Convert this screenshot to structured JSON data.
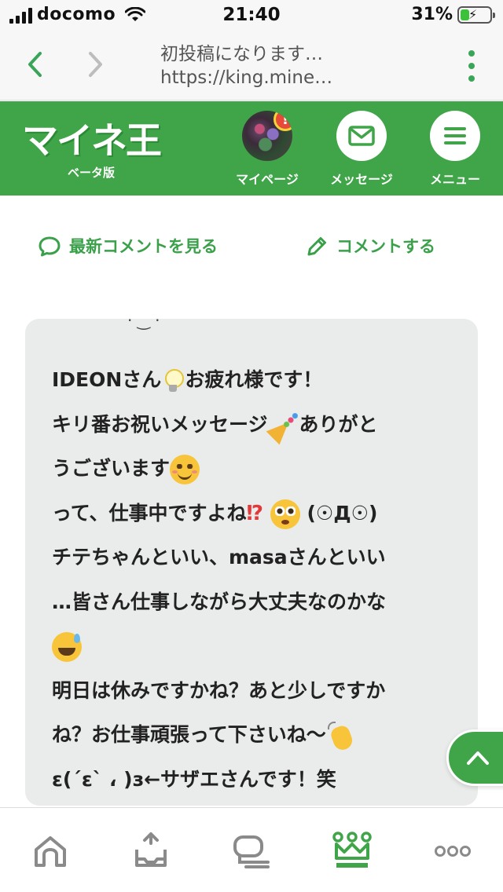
{
  "status_bar": {
    "carrier": "docomo",
    "time": "21:40",
    "battery_percent": "31%",
    "battery_level": 0.31,
    "charging": true
  },
  "browser": {
    "page_title": "初投稿になります…",
    "url": "https://king.mine…",
    "back_icon": "chevron-left-icon",
    "forward_icon": "chevron-right-icon",
    "menu_icon": "kebab-icon"
  },
  "header": {
    "logo_text": "マイネ王",
    "logo_sub": "ベータ版",
    "nav": [
      {
        "label": "マイページ",
        "icon": "avatar",
        "badge": "!"
      },
      {
        "label": "メッセージ",
        "icon": "envelope-icon"
      },
      {
        "label": "メニュー",
        "icon": "hamburger-icon"
      }
    ],
    "colors": {
      "brand_green": "#3fa548",
      "accent_yellow": "#f6e05a",
      "alert_red": "#e84a3a"
    }
  },
  "actions": {
    "latest_comments": "最新コメントを見る",
    "write_comment": "コメントする"
  },
  "comment": {
    "lines": [
      "IDEONさん",
      "お疲れ様です！",
      "キリ番お祝いメッセージ",
      "ありがと",
      "うございます",
      "って、仕事中ですよね",
      "(☉Д☉)",
      "チテちゃんといい、masaさんといい",
      "…皆さん仕事しながら大丈夫なのかな",
      "明日は休みですかね？あと少しですか",
      "ね？お仕事頑張って下さいね〜",
      "ε(´ε` ، )з←サザエさんです！笑"
    ],
    "emojis": [
      "light-bulb-icon",
      "party-popper-icon",
      "smiling-face-icon",
      "exclamation-question-icon",
      "flushed-face-icon",
      "sweat-smile-icon",
      "waving-hand-icon"
    ]
  },
  "tab_bar": {
    "items": [
      "home-icon",
      "post-icon",
      "timeline-icon",
      "crown-icon",
      "more-icon"
    ],
    "active_color": "#3fa548",
    "inactive_color": "#8a8a8a"
  }
}
